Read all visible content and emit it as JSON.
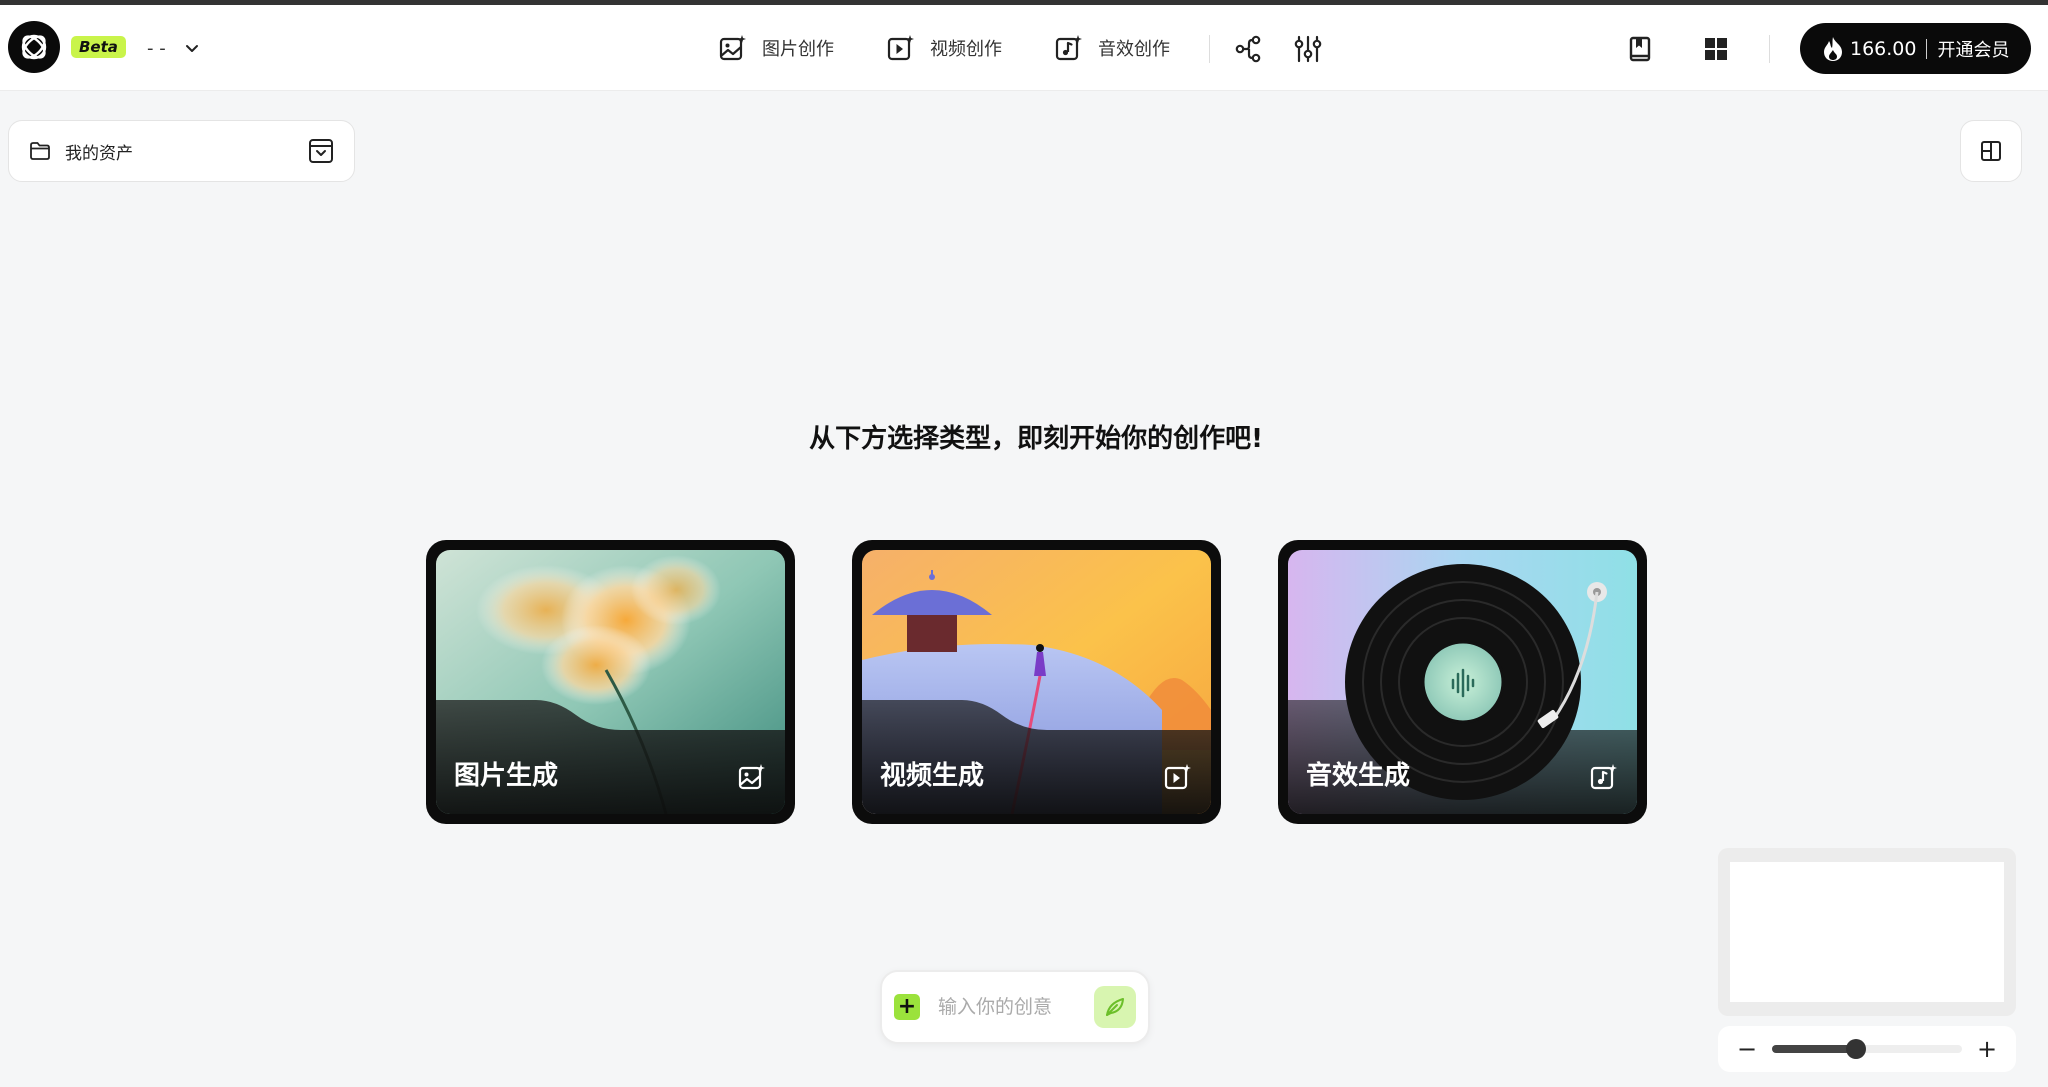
{
  "header": {
    "beta_label": "Beta",
    "project_name": "- -",
    "nav": [
      {
        "label": "图片创作",
        "icon": "image-sparkle-icon"
      },
      {
        "label": "视频创作",
        "icon": "video-sparkle-icon"
      },
      {
        "label": "音效创作",
        "icon": "music-sparkle-icon"
      }
    ],
    "tools": [
      "workflow-icon",
      "sliders-icon"
    ],
    "right_icons": [
      "bookmark-icon",
      "apps-grid-icon"
    ],
    "credits": {
      "value": "166.00",
      "separator": "|",
      "member_label": "开通会员",
      "icon": "flame-icon"
    }
  },
  "assets": {
    "label": "我的资产",
    "icon": "folder-icon",
    "collapse_icon": "dropdown-box-icon"
  },
  "headline": "从下方选择类型，即刻开始你的创作吧!",
  "cards": [
    {
      "label": "图片生成",
      "icon": "image-sparkle-icon"
    },
    {
      "label": "视频生成",
      "icon": "video-sparkle-icon"
    },
    {
      "label": "音效生成",
      "icon": "music-sparkle-icon"
    }
  ],
  "prompt": {
    "plus": "+",
    "placeholder": "输入你的创意"
  },
  "zoom": {
    "minus": "−",
    "plus": "+",
    "level": 0.44
  },
  "colors": {
    "accent": "#c9f44a",
    "dark": "#0a0a0a",
    "send_bg": "#d8f5b0"
  }
}
